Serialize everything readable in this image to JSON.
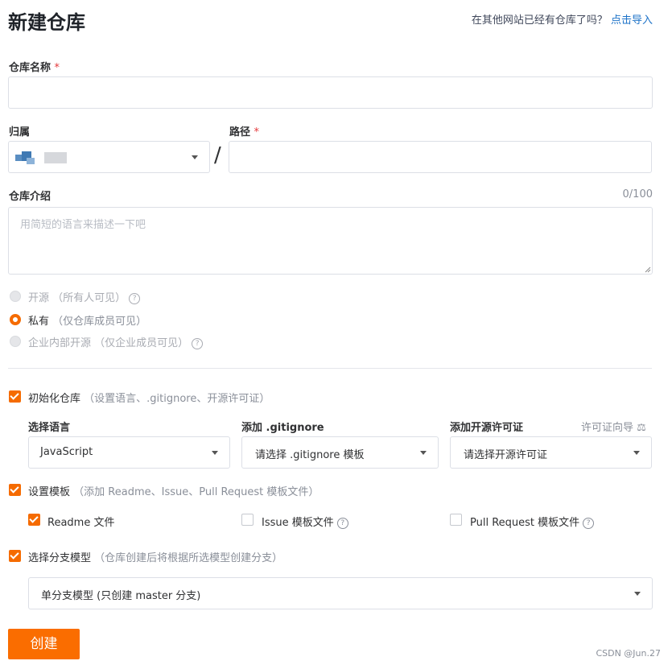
{
  "page": {
    "title": "新建仓库",
    "import_prompt": "在其他网站已经有仓库了吗？",
    "import_link": "点击导入"
  },
  "repo_name": {
    "label": "仓库名称",
    "required_mark": "*",
    "value": ""
  },
  "owner": {
    "label": "归属",
    "value": ""
  },
  "path": {
    "label": "路径",
    "required_mark": "*",
    "value": ""
  },
  "separator": "/",
  "description": {
    "label": "仓库介绍",
    "counter": "0/100",
    "placeholder": "用简短的语言来描述一下吧"
  },
  "visibility": {
    "options": [
      {
        "label": "开源",
        "note": "（所有人可见）",
        "state": "disabled",
        "help": true
      },
      {
        "label": "私有",
        "note": "（仅仓库成员可见）",
        "state": "checked",
        "help": false
      },
      {
        "label": "企业内部开源",
        "note": "（仅企业成员可见）",
        "state": "disabled",
        "help": true
      }
    ]
  },
  "init_repo": {
    "checked": true,
    "label": "初始化仓库",
    "note": "（设置语言、.gitignore、开源许可证）",
    "language": {
      "label": "选择语言",
      "value": "JavaScript"
    },
    "gitignore": {
      "label": "添加 .gitignore",
      "value": "请选择 .gitignore 模板"
    },
    "license": {
      "label": "添加开源许可证",
      "value": "请选择开源许可证",
      "guide": "许可证向导"
    }
  },
  "templates": {
    "checked": true,
    "label": "设置模板",
    "note": "（添加 Readme、Issue、Pull Request 模板文件）",
    "items": [
      {
        "label": "Readme 文件",
        "checked": true
      },
      {
        "label": "Issue 模板文件",
        "checked": false
      },
      {
        "label": "Pull Request 模板文件",
        "checked": false
      }
    ]
  },
  "branch_model": {
    "checked": true,
    "label": "选择分支模型",
    "note": "（仓库创建后将根据所选模型创建分支）",
    "value": "单分支模型 (只创建 master 分支)"
  },
  "submit": {
    "label": "创建"
  },
  "watermark": "CSDN @Jun.27",
  "colors": {
    "accent": "#f56b00",
    "link": "#1e73c8",
    "required": "#e4393c"
  }
}
